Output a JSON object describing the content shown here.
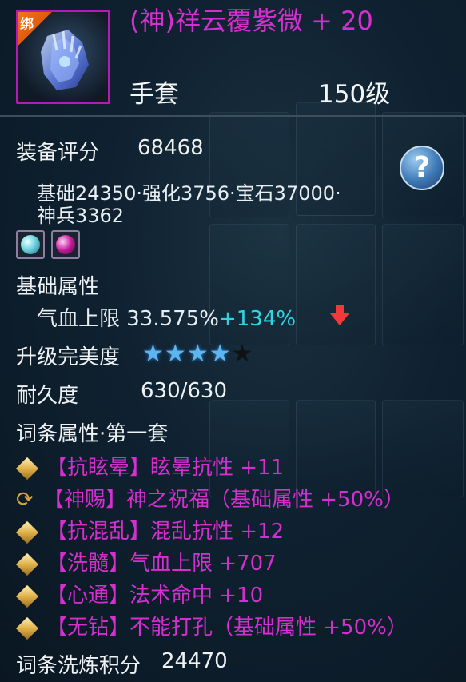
{
  "item": {
    "bind_label": "绑",
    "name": "(神)祥云覆紫微 + 20",
    "type": "手套",
    "level": "150级"
  },
  "score": {
    "label": "装备评分",
    "value": "68468",
    "breakdown_line1": "基础24350·强化3756·宝石37000·",
    "breakdown_line2": "神兵3362"
  },
  "help": {
    "icon": "question-icon",
    "label": "?"
  },
  "gems": [
    {
      "icon": "gem-cyan-icon",
      "color": "#6fd3df"
    },
    {
      "icon": "gem-magenta-icon",
      "color": "#c21a9b"
    }
  ],
  "base_attr": {
    "label": "基础属性",
    "stat_text": "气血上限 33.575%",
    "bonus_text": "+134%",
    "bonus_color": "#2ed6e3",
    "trend_icon": "down-arrow-icon"
  },
  "perfection": {
    "label": "升级完美度",
    "stars_filled": 4,
    "stars_total": 5
  },
  "durability": {
    "label": "耐久度",
    "value": "630/630"
  },
  "affix_section": {
    "label": "词条属性·第一套"
  },
  "affixes": [
    {
      "icon": "diamond-icon",
      "text": "【抗眩晕】眩晕抗性 +11"
    },
    {
      "icon": "swirl-icon",
      "text": "【神赐】神之祝福（基础属性 +50%）"
    },
    {
      "icon": "diamond-icon",
      "text": "【抗混乱】混乱抗性 +12"
    },
    {
      "icon": "diamond-icon",
      "text": "【洗髓】气血上限 +707"
    },
    {
      "icon": "diamond-icon",
      "text": "【心通】法术命中 +10"
    },
    {
      "icon": "diamond-icon",
      "text": "【无钻】不能打孔（基础属性 +50%）"
    }
  ],
  "refine_score": {
    "label": "词条洗炼积分",
    "value": "24470"
  },
  "colors": {
    "name_purple": "#d42fcf",
    "frame_purple": "#b21bb4",
    "bind_orange": "#ef7a1f"
  }
}
